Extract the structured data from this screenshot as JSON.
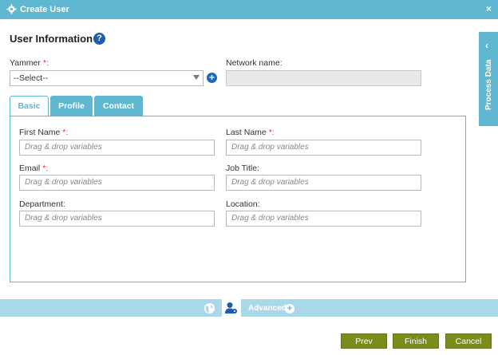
{
  "window": {
    "title": "Create User",
    "close_glyph": "×"
  },
  "section": {
    "title": "User Information",
    "help_glyph": "?"
  },
  "yammer": {
    "label": "Yammer",
    "required_mark": "*:",
    "value": "--Select--",
    "add_glyph": "+"
  },
  "network": {
    "label": "Network name:"
  },
  "side_panel": {
    "label": "Process Data",
    "chevron": "‹"
  },
  "tabs": [
    {
      "label": "Basic",
      "active": true
    },
    {
      "label": "Profile",
      "active": false
    },
    {
      "label": "Contact",
      "active": false
    }
  ],
  "fields": {
    "first_name": {
      "label": "First Name ",
      "required_mark": "*:",
      "placeholder": "Drag & drop variables"
    },
    "last_name": {
      "label": "Last Name ",
      "required_mark": "*:",
      "placeholder": "Drag & drop variables"
    },
    "email": {
      "label": "Email ",
      "required_mark": "*:",
      "placeholder": "Drag & drop variables"
    },
    "job_title": {
      "label": "Job Title:",
      "placeholder": "Drag & drop variables"
    },
    "department": {
      "label": "Department:",
      "placeholder": "Drag & drop variables"
    },
    "location": {
      "label": "Location:",
      "placeholder": "Drag & drop variables"
    }
  },
  "bottom_bar": {
    "advanced_label": "Advanced",
    "plus_glyph": "+"
  },
  "buttons": {
    "prev": "Prev",
    "finish": "Finish",
    "cancel": "Cancel"
  },
  "colors": {
    "accent": "#5fb7d1",
    "button": "#7a8d1b",
    "required": "#d33333",
    "help": "#1f5bb0"
  }
}
